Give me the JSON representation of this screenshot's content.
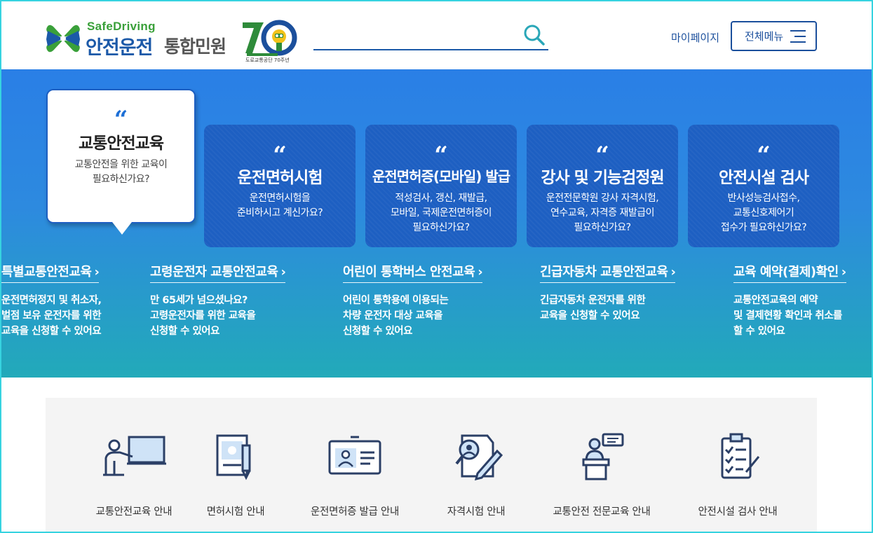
{
  "header": {
    "logo_en": "SafeDriving",
    "logo_ko": "안전운전",
    "logo_ko2": "통합민원",
    "anniversary_caption": "도로교통공단 70주년",
    "search_placeholder": "",
    "mypage_label": "마이페이지",
    "allmenu_label": "전체메뉴"
  },
  "hero": {
    "cards": [
      {
        "title": "교통안전교육",
        "desc": "교통안전을 위한 교육이\n필요하신가요?",
        "active": true
      },
      {
        "title": "운전면허시험",
        "desc": "운전면허시험을\n준비하시고 계신가요?"
      },
      {
        "title": "운전면허증(모바일) 발급",
        "desc": "적성검사, 갱신, 재발급,\n모바일, 국제운전면허증이\n필요하신가요?"
      },
      {
        "title": "강사 및 기능검정원",
        "desc": "운전전문학원 강사 자격시험,\n연수교육, 자격증 재발급이\n필요하신가요?"
      },
      {
        "title": "안전시설 검사",
        "desc": "반사성능검사접수,\n교통신호제어기\n접수가 필요하신가요?"
      }
    ],
    "quote_mark": "“",
    "sublinks": [
      {
        "title": "특별교통안전교육",
        "desc": "운전면허정지 및 취소자,\n벌점 보유 운전자를 위한\n교육을 신청할 수 있어요"
      },
      {
        "title": "고령운전자 교통안전교육",
        "desc": "만 65세가 넘으셨나요?\n고령운전자를 위한 교육을\n신청할 수 있어요"
      },
      {
        "title": "어린이 통학버스 안전교육",
        "desc": "어린이 통학용에 이용되는\n차량 운전자 대상 교육을\n신청할 수 있어요"
      },
      {
        "title": "긴급자동차 교통안전교육",
        "desc": "긴급자동차 운전자를 위한\n교육을 신청할 수 있어요"
      },
      {
        "title": "교육 예약(결제)확인",
        "desc": "교통안전교육의 예약\n및 결제현황 확인과 취소를\n할 수 있어요"
      }
    ],
    "chevron": "›"
  },
  "quick_menu": [
    {
      "label": "교통안전교육 안내",
      "icon": "presentation-board-icon"
    },
    {
      "label": "면허시험 안내",
      "icon": "document-pencil-icon"
    },
    {
      "label": "운전면허증 발급 안내",
      "icon": "id-card-icon"
    },
    {
      "label": "자격시험 안내",
      "icon": "magnifier-pencil-icon"
    },
    {
      "label": "교통안전 전문교육 안내",
      "icon": "lecturer-podium-icon"
    },
    {
      "label": "안전시설 검사 안내",
      "icon": "clipboard-checklist-icon"
    }
  ],
  "colors": {
    "primary": "#1b4f9c",
    "card_blue": "#1d5fc2",
    "hero_top": "#2a7fe6",
    "hero_bottom": "#22aab9",
    "logo_green": "#3aa03a"
  }
}
